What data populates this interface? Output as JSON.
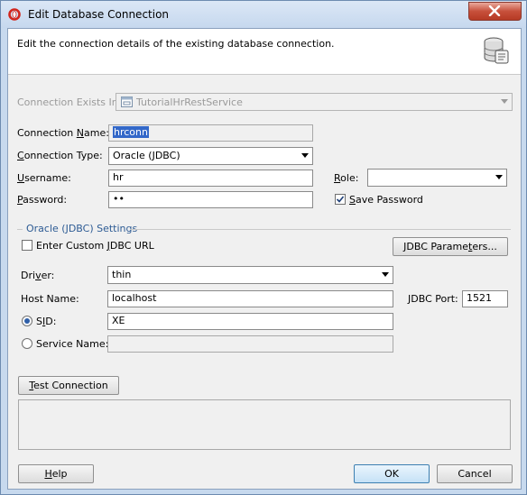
{
  "window": {
    "title": "Edit Database Connection",
    "app_icon": "oracle-logo-icon",
    "close_icon": "close-icon"
  },
  "header": {
    "description": "Edit the connection details of the existing database connection.",
    "icon": "database-edit-icon"
  },
  "connection_exists_in": {
    "label": "Connection Exists In:",
    "value": "TutorialHrRestService",
    "icon": "application-icon"
  },
  "connection_name": {
    "label_pre": "Connection ",
    "label_key": "N",
    "label_post": "ame:",
    "value": "hrconn"
  },
  "connection_type": {
    "label_pre": "",
    "label_key": "C",
    "label_post": "onnection Type:",
    "value": "Oracle (JDBC)"
  },
  "username": {
    "label_pre": "",
    "label_key": "U",
    "label_post": "sername:",
    "value": "hr"
  },
  "role": {
    "label_pre": "",
    "label_key": "R",
    "label_post": "ole:",
    "value": ""
  },
  "password": {
    "label_pre": "",
    "label_key": "P",
    "label_post": "assword:",
    "value": "••"
  },
  "save_password": {
    "label_pre": "",
    "label_key": "S",
    "label_post": "ave Password",
    "checked": true
  },
  "jdbc_settings": {
    "group_title": "Oracle (JDBC) Settings",
    "custom_url": {
      "label_pre": "Enter Custom ",
      "label_key": "J",
      "label_post": "DBC URL",
      "checked": false
    },
    "parameters_button": {
      "label_pre": "JDBC Parame",
      "label_key": "t",
      "label_post": "ers..."
    },
    "driver": {
      "label_pre": "Dri",
      "label_key": "v",
      "label_post": "er:",
      "value": "thin"
    },
    "host_name": {
      "label": "Host Name:",
      "value": "localhost"
    },
    "jdbc_port": {
      "label": "JDBC Port:",
      "value": "1521"
    },
    "sid": {
      "label_pre": "S",
      "label_key": "I",
      "label_post": "D:",
      "value": "XE",
      "selected": true
    },
    "service_name": {
      "label": "Service Name:",
      "value": "",
      "selected": false
    }
  },
  "test_connection_button": {
    "label_pre": "",
    "label_key": "T",
    "label_post": "est Connection"
  },
  "status_text": "",
  "footer": {
    "help": {
      "label_pre": "",
      "label_key": "H",
      "label_post": "elp"
    },
    "ok": "OK",
    "cancel": "Cancel"
  }
}
